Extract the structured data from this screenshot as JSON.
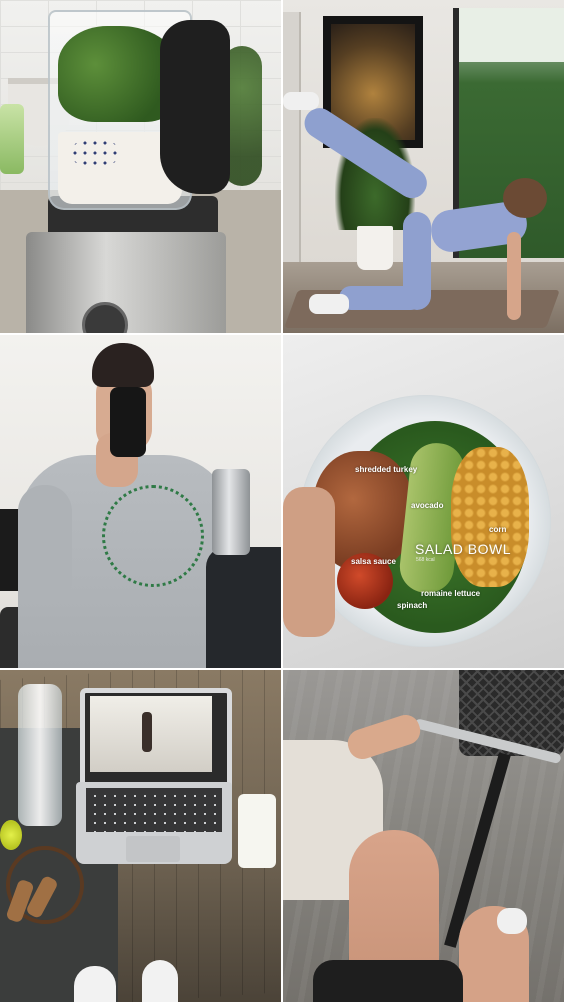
{
  "salad": {
    "title": "SALAD BOWL",
    "subtitle": "568 kcal",
    "labels": {
      "turkey": "shredded turkey",
      "avocado": "avocado",
      "corn": "corn",
      "salsa": "salsa sauce",
      "lettuce": "romaine lettuce",
      "spinach": "spinach"
    }
  },
  "sweater_print": "tomorrow yesterday today",
  "colors": {
    "sweater_print": "#2f7a46",
    "leggings": "#8fa0cf",
    "background": "#ffffff"
  }
}
